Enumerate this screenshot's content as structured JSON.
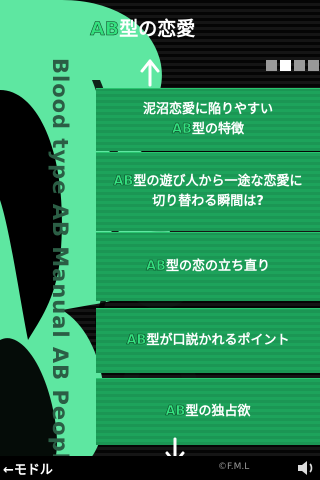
{
  "header": {
    "title_prefix": "AB",
    "title_suffix": "型の恋愛"
  },
  "side_text": "Blood type AB Manual AB People",
  "pagination": {
    "total": 4,
    "current": 2
  },
  "menu": [
    {
      "lines": [
        [
          {
            "t": "泥沼恋愛に陥りやすい",
            "ab": false
          }
        ],
        [
          {
            "t": "AB",
            "ab": true
          },
          {
            "t": "型の特徴",
            "ab": false
          }
        ]
      ]
    },
    {
      "lines": [
        [
          {
            "t": "AB",
            "ab": true
          },
          {
            "t": "型の遊び人から一途な恋愛に",
            "ab": false
          }
        ],
        [
          {
            "t": "切り替わる瞬間は?",
            "ab": false
          }
        ]
      ]
    },
    {
      "lines": [
        [
          {
            "t": "AB",
            "ab": true
          },
          {
            "t": "型の恋の立ち直り",
            "ab": false
          }
        ]
      ]
    },
    {
      "lines": [
        [
          {
            "t": "AB",
            "ab": true
          },
          {
            "t": "型が口説かれるポイント",
            "ab": false
          }
        ]
      ]
    },
    {
      "lines": [
        [
          {
            "t": "AB",
            "ab": true
          },
          {
            "t": "型の独占欲",
            "ab": false
          }
        ]
      ]
    }
  ],
  "footer": {
    "back_label": "←モドル",
    "copyright": "©F.M.L"
  },
  "colors": {
    "accent_green": "#34e07f",
    "menu_green": "#1da35b",
    "big_letter_green": "#5ee7a1"
  },
  "icons": {
    "up": "arrow-up-icon",
    "down": "arrow-down-icon",
    "sound": "speaker-icon"
  }
}
